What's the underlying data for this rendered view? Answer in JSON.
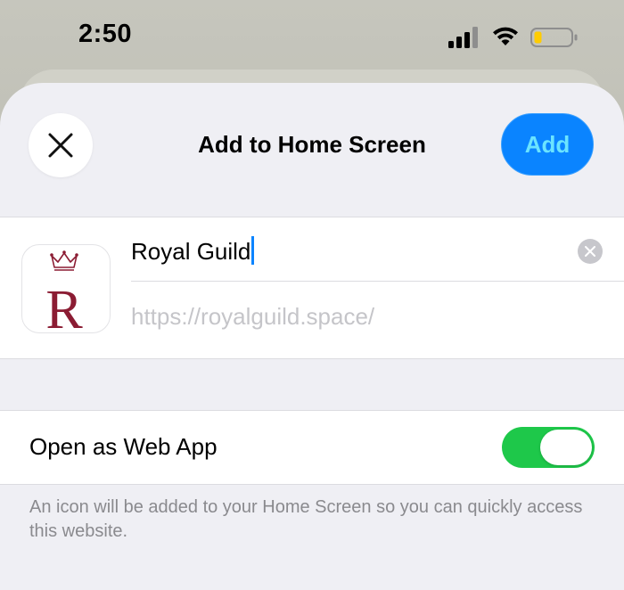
{
  "status_bar": {
    "time": "2:50"
  },
  "sheet": {
    "title": "Add to Home Screen",
    "add_label": "Add"
  },
  "site": {
    "name": "Royal Guild",
    "url": "https://royalguild.space/",
    "icon_letter": "R"
  },
  "web_app": {
    "label": "Open as Web App",
    "enabled": true
  },
  "footnote": "An icon will be added to your Home Screen so you can quickly access this website.",
  "colors": {
    "accent": "#0a84ff",
    "toggle_on": "#1ec84a",
    "icon_maroon": "#8b1c33",
    "battery_low": "#ffcc00"
  }
}
